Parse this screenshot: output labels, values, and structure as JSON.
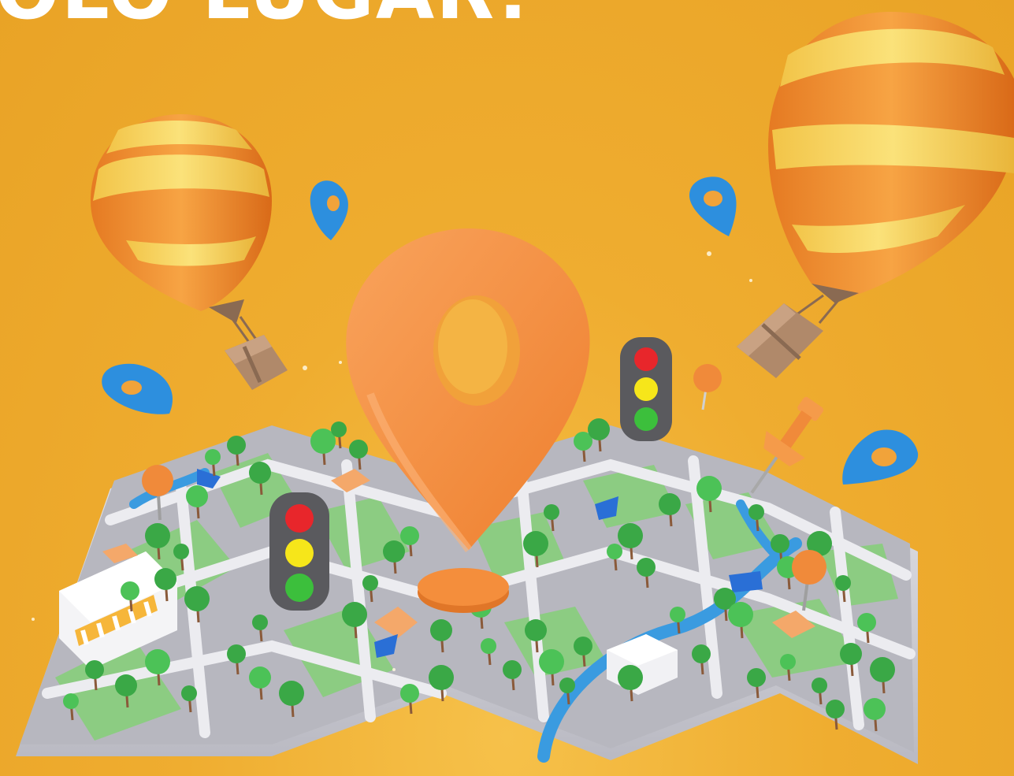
{
  "headline": {
    "text": "OLO LUGAR!"
  },
  "colors": {
    "background": "#efab2c",
    "pin_orange": "#f4913f",
    "pin_blue": "#2d8fde",
    "map_road": "#c9c9cf",
    "map_park": "#8ccc82",
    "tree_green": "#3fb54a",
    "river_blue": "#3a9be0",
    "light_red": "#e8262b",
    "light_yellow": "#f6e61a",
    "light_green": "#3cbf3c",
    "balloon_orange": "#f08a2c",
    "balloon_yellow": "#f7d65a",
    "box_brown": "#b0896a"
  },
  "icons": [
    "hot-air-balloon-icon",
    "location-pin-icon",
    "traffic-light-icon",
    "push-pin-icon",
    "parcel-box-icon",
    "tree-icon",
    "flag-icon"
  ]
}
